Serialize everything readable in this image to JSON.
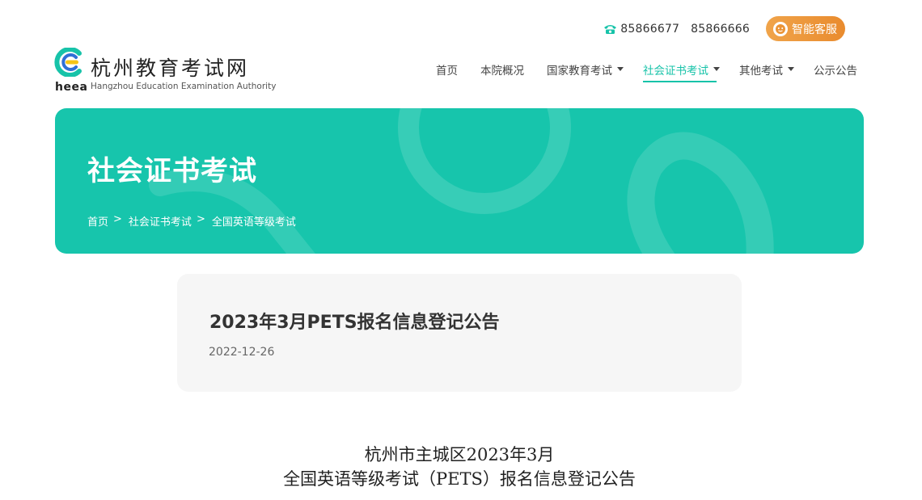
{
  "header": {
    "phone_1": "85866677",
    "phone_2": "85866666",
    "service_label": "智能客服",
    "icons": {
      "phone": "phone-icon",
      "service": "chat-face-icon"
    }
  },
  "logo": {
    "mark_text": "heea",
    "title": "杭州教育考试网",
    "subtitle": "Hangzhou Education Examination Authority",
    "colors": {
      "green": "#17c3a9",
      "yellow": "#f5c518",
      "blue": "#2f6fd6"
    }
  },
  "nav": {
    "items": [
      {
        "label": "首页"
      },
      {
        "label": "本院概况"
      },
      {
        "label": "国家教育考试"
      },
      {
        "label": "社会证书考试"
      },
      {
        "label": "其他考试"
      },
      {
        "label": "公示公告"
      }
    ],
    "active_index": 3,
    "accent": "#17c3a9"
  },
  "banner": {
    "title": "社会证书考试",
    "breadcrumb": [
      "首页",
      "社会证书考试",
      "全国英语等级考试"
    ],
    "separator": ">",
    "background": "#17c5ac"
  },
  "article": {
    "title": "2023年3月PETS报名信息登记公告",
    "date": "2022-12-26"
  },
  "content": {
    "heading_line_1": "杭州市主城区2023年3月",
    "heading_line_2": "全国英语等级考试（PETS）报名信息登记公告"
  }
}
